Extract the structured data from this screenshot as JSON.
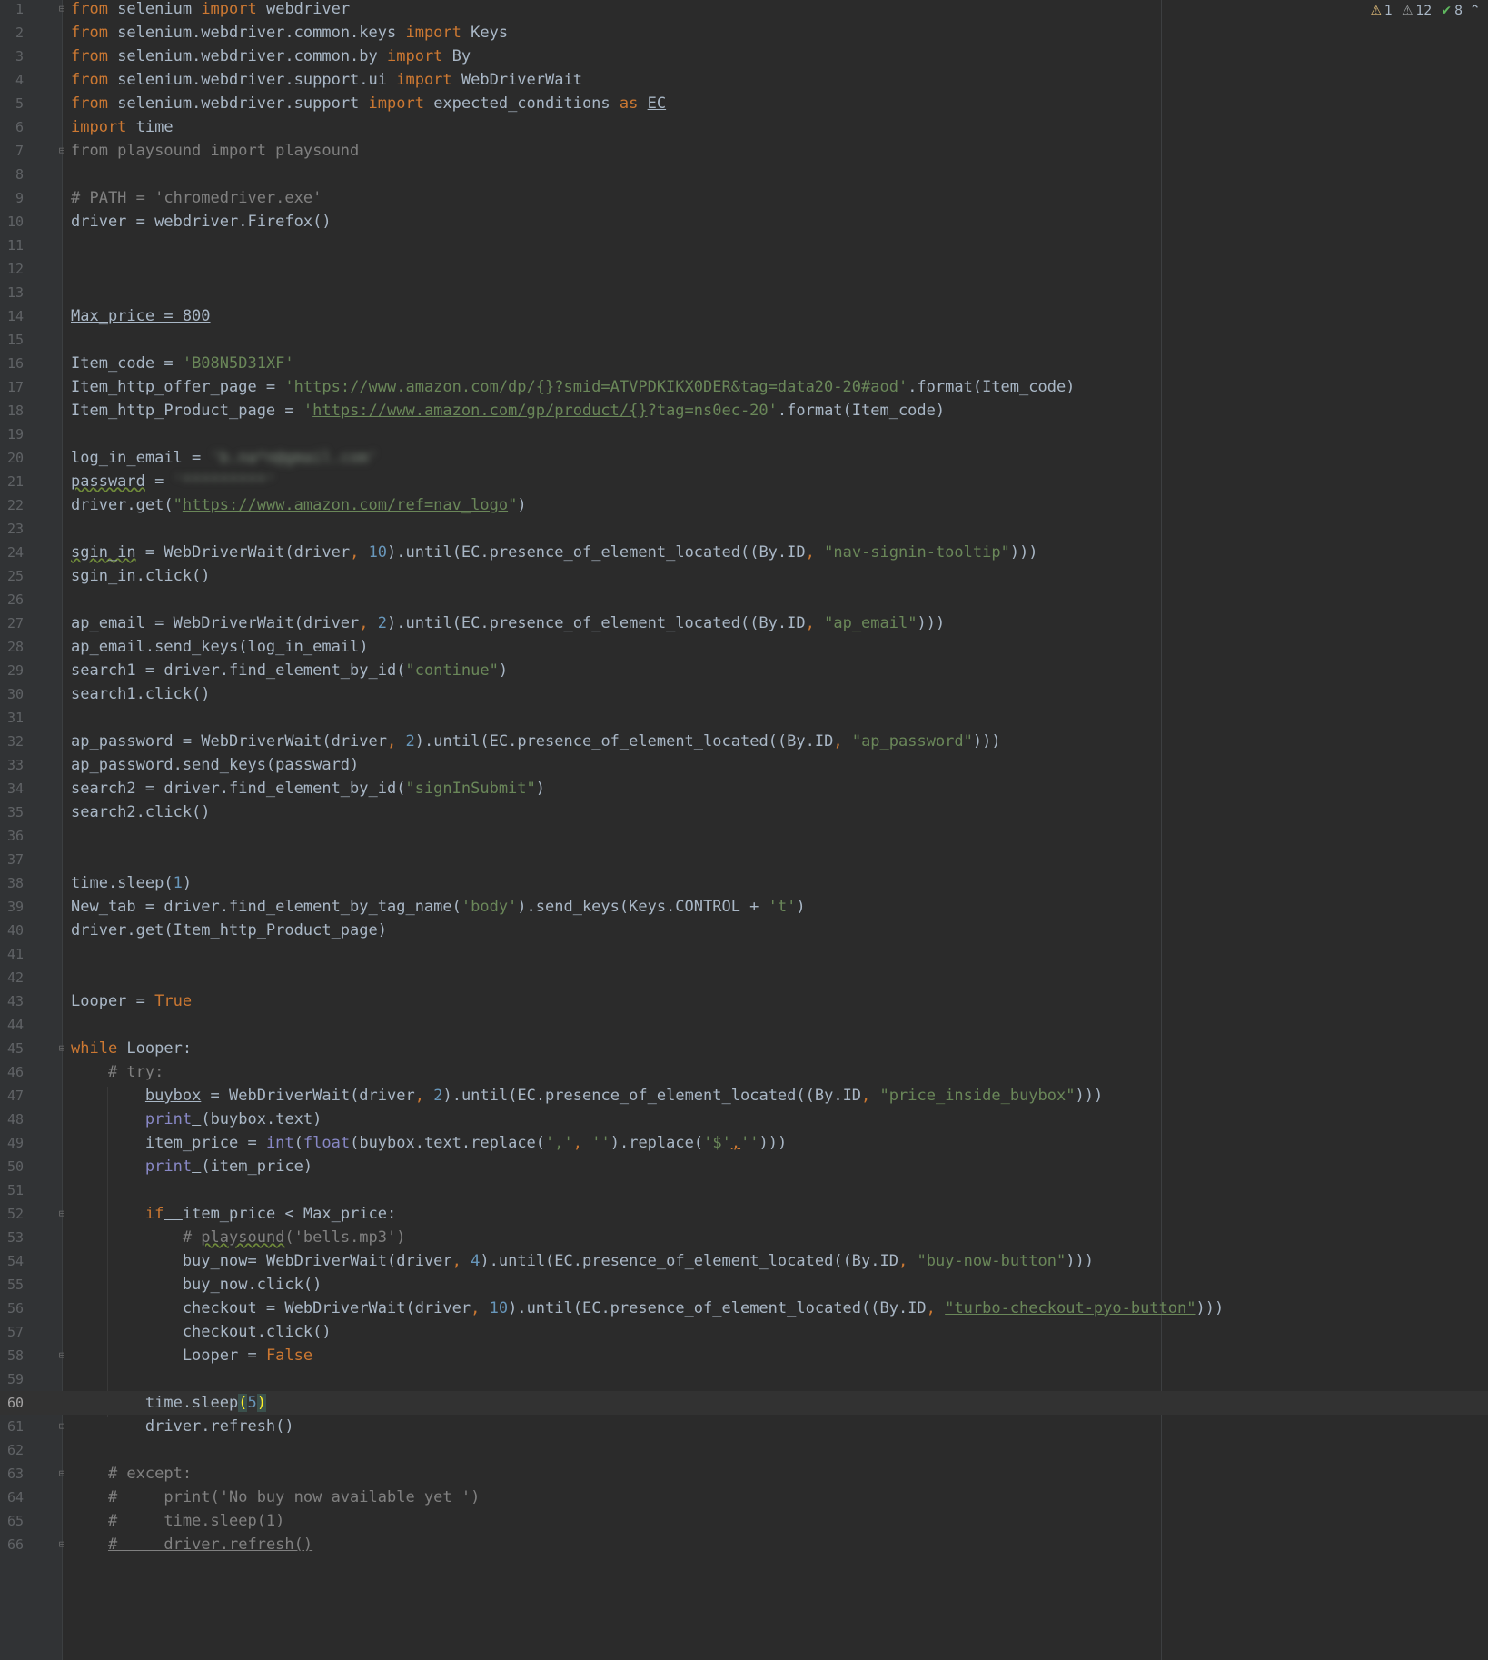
{
  "editor": {
    "inspections": {
      "warnings": "1",
      "weak_warnings": "12",
      "typos": "8"
    },
    "current_line": 60
  },
  "lines": {
    "1": {
      "a": "from",
      "b": " selenium ",
      "c": "import",
      "d": " webdriver"
    },
    "2": {
      "a": "from",
      "b": " selenium.webdriver.common.keys ",
      "c": "import",
      "d": " Keys"
    },
    "3": {
      "a": "from",
      "b": " selenium.webdriver.common.by ",
      "c": "import",
      "d": " By"
    },
    "4": {
      "a": "from",
      "b": " selenium.webdriver.support.ui ",
      "c": "import",
      "d": " WebDriverWait"
    },
    "5": {
      "a": "from",
      "b": " selenium.webdriver.support ",
      "c": "import",
      "d": " expected_conditions ",
      "e": "as",
      "f": " ",
      "g": "EC"
    },
    "6": {
      "a": "import",
      "b": " time"
    },
    "7": {
      "a": "from playsound import playsound"
    },
    "9": {
      "a": "# PATH = 'chromedriver.exe'"
    },
    "10": {
      "a": "driver = webdriver.Firefox()"
    },
    "14": {
      "a": "Max_price = 800"
    },
    "16": {
      "a": "Item_code = ",
      "b": "'B08N5D31XF'"
    },
    "17": {
      "a": "Item_http_offer_page = ",
      "b": "'",
      "c": "https://www.amazon.com/dp/{}?smid=ATVPDKIKX0DER&tag=data20-20#aod",
      "d": "'",
      "e": ".format(Item_code)"
    },
    "18": {
      "a": "Item_http_Product_page = ",
      "b": "'",
      "c": "https://www.amazon.com/gp/product/{}",
      "d": "?tag=ns0ec-20'",
      "e": ".format(Item_code)"
    },
    "20": {
      "a": "log_in_email = ",
      "b": "'b.na*n@gmail.com'"
    },
    "21": {
      "a": "passward",
      "b": " = ",
      "c": "'*********'"
    },
    "22": {
      "a": "driver.get(",
      "b": "\"",
      "c": "https://www.amazon.com/ref=nav_logo",
      "d": "\"",
      "e": ")"
    },
    "24": {
      "a": "sgin_in",
      "b": " = WebDriverWait(driver",
      "c": ",",
      "d": " ",
      "e": "10",
      "f": ").until(EC.presence_of_element_located((By.ID",
      "g": ",",
      "h": " ",
      "i": "\"nav-signin-tooltip\"",
      "j": ")))"
    },
    "25": {
      "a": "sgin_in.click()"
    },
    "27": {
      "a": "ap_email = WebDriverWait(driver",
      "b": ",",
      "c": " ",
      "d": "2",
      "e": ").until(EC.presence_of_element_located((By.ID",
      "f": ",",
      "g": " ",
      "h": "\"ap_email\"",
      "i": ")))"
    },
    "28": {
      "a": "ap_email.send_keys(log_in_email)"
    },
    "29": {
      "a": "search1 = driver.find_element_by_id(",
      "b": "\"continue\"",
      "c": ")"
    },
    "30": {
      "a": "search1.click()"
    },
    "32": {
      "a": "ap_password = WebDriverWait(driver",
      "b": ",",
      "c": " ",
      "d": "2",
      "e": ").until(EC.presence_of_element_located((By.ID",
      "f": ",",
      "g": " ",
      "h": "\"ap_password\"",
      "i": ")))"
    },
    "33": {
      "a": "ap_password.send_keys(passward)"
    },
    "34": {
      "a": "search2 = driver.find_element_by_id(",
      "b": "\"signInSubmit\"",
      "c": ")"
    },
    "35": {
      "a": "search2.click()"
    },
    "38": {
      "a": "time.sleep(",
      "b": "1",
      "c": ")"
    },
    "39": {
      "a": "New_tab = driver.find_element_by_tag_name(",
      "b": "'body'",
      "c": ").send_keys(Keys.CONTROL + ",
      "d": "'t'",
      "e": ")"
    },
    "40": {
      "a": "driver.get(Item_http_Product_page)"
    },
    "43": {
      "a": "Looper = ",
      "b": "True"
    },
    "45": {
      "a": "while",
      "b": " Looper:"
    },
    "46": {
      "a": "    # try:"
    },
    "47": {
      "a": "        ",
      "b": "buybox",
      "c": " = WebDriverWait(driver",
      "d": ",",
      "e": " ",
      "f": "2",
      "g": ").until(EC.presence_of_element_located((By.ID",
      "h": ",",
      "i": " ",
      "j": "\"price_inside_buybox\"",
      "k": ")))"
    },
    "48": {
      "a": "        ",
      "b": "print",
      "c": " ",
      "d": "(buybox.text)"
    },
    "49": {
      "a": "        item_price = ",
      "b": "int",
      "c": "(",
      "d": "float",
      "e": "(buybox.text.replace(",
      "f": "','",
      "g": ",",
      "h": " ",
      "i": "''",
      "j": ").replace(",
      "k": "'$'",
      "l": ",",
      "m": "''",
      "n": ")))"
    },
    "50": {
      "a": "        ",
      "b": "print",
      "c": " ",
      "d": "(item_price)"
    },
    "52": {
      "a": "        ",
      "b": "if",
      "c": "  ",
      "d": "item_price < Max_price:"
    },
    "53": {
      "a": "            # ",
      "b": "playsound",
      "c": "('bells.mp3')"
    },
    "54": {
      "a": "            buy_now",
      "b": "=",
      "c": " WebDriverWait(driver",
      "d": ",",
      "e": " ",
      "f": "4",
      "g": ").until(EC.presence_of_element_located((By.ID",
      "h": ",",
      "i": " ",
      "j": "\"buy-now-button\"",
      "k": ")))"
    },
    "55": {
      "a": "            buy_now.click()"
    },
    "56": {
      "a": "            checkout = WebDriverWait(driver",
      "b": ",",
      "c": " ",
      "d": "10",
      "e": ").until(EC.presence_of_element_located((By.ID",
      "f": ",",
      "g": " ",
      "h": "\"turbo-checkout-pyo-button\"",
      "i": ")))"
    },
    "57": {
      "a": "            checkout.click()"
    },
    "58": {
      "a": "            Looper = ",
      "b": "False"
    },
    "60": {
      "a": "        time.sleep",
      "b": "(",
      "c": "5",
      "d": ")"
    },
    "61": {
      "a": "        driver.refresh()"
    },
    "63": {
      "a": "    # except:"
    },
    "64": {
      "a": "    #     print('No buy now available yet ')"
    },
    "65": {
      "a": "    #     time.sleep(1)"
    },
    "66": {
      "a": "    ",
      "b": "#     driver.refresh()"
    }
  },
  "line_numbers": [
    "1",
    "2",
    "3",
    "4",
    "5",
    "6",
    "7",
    "8",
    "9",
    "10",
    "11",
    "12",
    "13",
    "14",
    "15",
    "16",
    "17",
    "18",
    "19",
    "20",
    "21",
    "22",
    "23",
    "24",
    "25",
    "26",
    "27",
    "28",
    "29",
    "30",
    "31",
    "32",
    "33",
    "34",
    "35",
    "36",
    "37",
    "38",
    "39",
    "40",
    "41",
    "42",
    "43",
    "44",
    "45",
    "46",
    "47",
    "48",
    "49",
    "50",
    "51",
    "52",
    "53",
    "54",
    "55",
    "56",
    "57",
    "58",
    "59",
    "60",
    "61",
    "62",
    "63",
    "64",
    "65",
    "66"
  ],
  "icons": {
    "warning": "warning-triangle-icon",
    "weak_warning": "weak-warning-icon",
    "typo": "typo-check-icon",
    "collapse": "chevron-up-icon",
    "fold": "fold-marker-icon"
  }
}
